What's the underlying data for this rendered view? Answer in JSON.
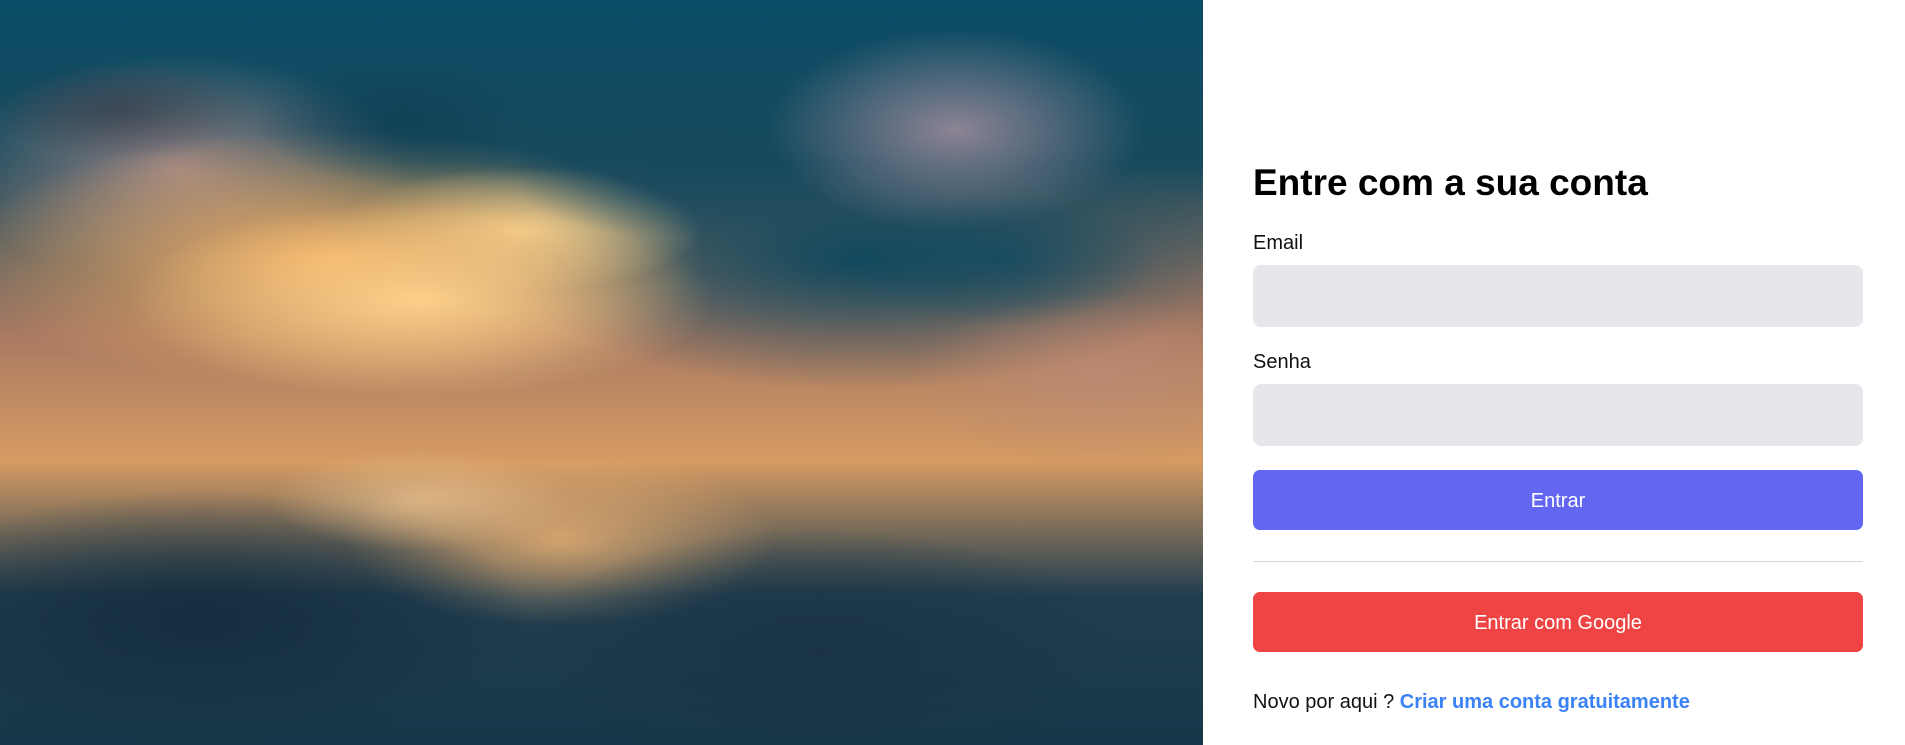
{
  "login": {
    "title": "Entre com a sua conta",
    "email_label": "Email",
    "email_value": "",
    "email_placeholder": "",
    "password_label": "Senha",
    "password_value": "",
    "password_placeholder": "",
    "submit_label": "Entrar",
    "google_label": "Entrar com Google",
    "signup_prompt": "Novo por aqui ? ",
    "signup_link": "Criar uma conta gratuitamente"
  },
  "colors": {
    "primary": "#6366f1",
    "google": "#ef4444",
    "link": "#3b82f6",
    "input_background": "#e5e7eb"
  }
}
